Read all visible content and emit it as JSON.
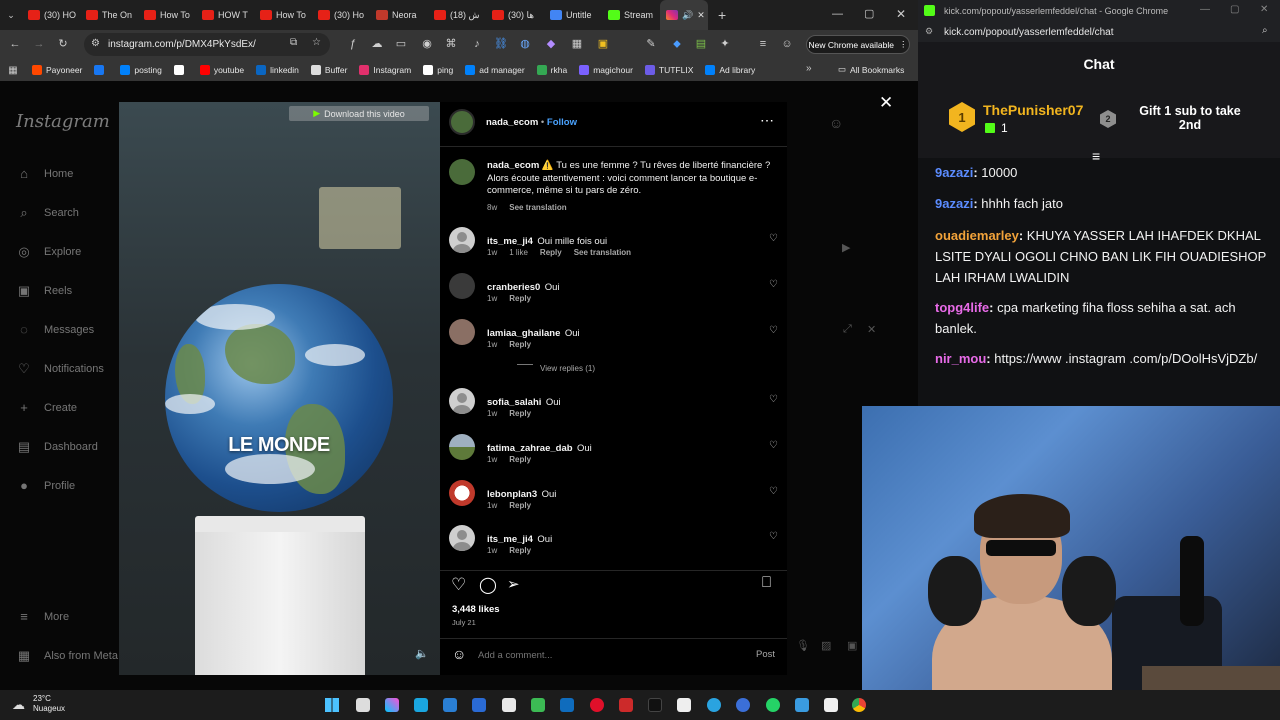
{
  "browser_left": {
    "tabs": [
      {
        "label": "(30) HO",
        "color": "#e62117"
      },
      {
        "label": "The On",
        "color": "#e62117"
      },
      {
        "label": "How To",
        "color": "#e62117"
      },
      {
        "label": "HOW T",
        "color": "#e62117"
      },
      {
        "label": "How To",
        "color": "#e62117"
      },
      {
        "label": "(30) Ho",
        "color": "#e62117"
      },
      {
        "label": "Neora",
        "color": "#c0392b"
      },
      {
        "label": "(18) ش",
        "color": "#e62117"
      },
      {
        "label": "(30) ها",
        "color": "#e62117"
      },
      {
        "label": "Untitle",
        "color": "#4285f4"
      },
      {
        "label": "Stream",
        "color": "#53fc18"
      }
    ],
    "url": "instagram.com/p/DMX4PkYsdEx/",
    "chrome_available": "New Chrome available",
    "bookmarks": [
      {
        "label": "Payoneer",
        "color": "#ff4800"
      },
      {
        "label": "",
        "color": "#1877f2"
      },
      {
        "label": "posting",
        "color": "#0081fb"
      },
      {
        "label": "",
        "color": "#ffffff"
      },
      {
        "label": "youtube",
        "color": "#ff0000"
      },
      {
        "label": "linkedin",
        "color": "#0a66c2"
      },
      {
        "label": "Buffer",
        "color": "#dddddd"
      },
      {
        "label": "Instagram",
        "color": "#e1306c"
      },
      {
        "label": "ping",
        "color": "#ffffff"
      },
      {
        "label": "ad manager",
        "color": "#0081fb"
      },
      {
        "label": "rkha",
        "color": "#34a853"
      },
      {
        "label": "magichour",
        "color": "#7b61ff"
      },
      {
        "label": "TUTFLIX",
        "color": "#6c5ce7"
      },
      {
        "label": "Ad library",
        "color": "#0081fb"
      }
    ],
    "all_bookmarks": "All Bookmarks"
  },
  "instagram": {
    "logo": "Instagram",
    "nav": [
      {
        "label": "Home",
        "icon": "home-icon",
        "glyph": "⌂"
      },
      {
        "label": "Search",
        "icon": "search-icon",
        "glyph": "⌕"
      },
      {
        "label": "Explore",
        "icon": "compass-icon",
        "glyph": "◎"
      },
      {
        "label": "Reels",
        "icon": "reels-icon",
        "glyph": "▣"
      },
      {
        "label": "Messages",
        "icon": "messenger-icon",
        "glyph": "◌"
      },
      {
        "label": "Notifications",
        "icon": "heart-icon",
        "glyph": "♡"
      },
      {
        "label": "Create",
        "icon": "plus-icon",
        "glyph": "+"
      },
      {
        "label": "Dashboard",
        "icon": "dashboard-icon",
        "glyph": "▤"
      },
      {
        "label": "Profile",
        "icon": "avatar-icon",
        "glyph": "●"
      }
    ],
    "more": "More",
    "also_from_meta": "Also from Meta",
    "video": {
      "download_label": "Download this video",
      "overlay_text": "LE MONDE"
    },
    "post": {
      "author": "nada_ecom",
      "follow": "Follow",
      "caption_user": "nada_ecom",
      "caption_lines": [
        "⚠️ Tu es une femme ? Tu rêves de liberté financière ?",
        "Alors écoute attentivement : voici comment lancer ta boutique e-",
        "commerce, même si tu pars de zéro."
      ],
      "caption_age": "8w",
      "see_translation": "See translation",
      "comments": [
        {
          "user": "its_me_ji4",
          "text": "Oui mille fois oui",
          "age": "1w",
          "likes": "1 like",
          "reply": "Reply",
          "translation": "See translation"
        },
        {
          "user": "cranberies0",
          "text": "Oui",
          "age": "1w",
          "likes": "",
          "reply": "Reply",
          "translation": ""
        },
        {
          "user": "lamiaa_ghailane",
          "text": "Oui",
          "age": "1w",
          "likes": "",
          "reply": "Reply",
          "translation": ""
        },
        {
          "user": "sofia_salahi",
          "text": "Oui",
          "age": "1w",
          "likes": "",
          "reply": "Reply",
          "translation": ""
        },
        {
          "user": "fatima_zahrae_dab",
          "text": "Oui",
          "age": "1w",
          "likes": "",
          "reply": "Reply",
          "translation": ""
        },
        {
          "user": "lebonplan3",
          "text": "Oui",
          "age": "1w",
          "likes": "",
          "reply": "Reply",
          "translation": ""
        },
        {
          "user": "its_me_ji4",
          "text": "Oui",
          "age": "1w",
          "likes": "",
          "reply": "Reply",
          "translation": ""
        }
      ],
      "view_replies": "View replies (1)",
      "likes_count": "3,448 likes",
      "date": "July 21",
      "add_comment_placeholder": "Add a comment...",
      "post_button": "Post"
    }
  },
  "browser_right": {
    "window_title": "kick.com/popout/yasserlemfeddel/chat - Google Chrome",
    "url": "kick.com/popout/yasserlemfeddel/chat",
    "chat_title": "Chat",
    "gifter": {
      "rank": "1",
      "name": "ThePunisher07",
      "count": "1",
      "next_rank": "2",
      "cta": "Gift 1 sub to take 2nd"
    },
    "messages": [
      {
        "user": "9azazi",
        "color": "#5b8cff",
        "text": "10000"
      },
      {
        "user": "9azazi",
        "color": "#5b8cff",
        "text": "hhhh fach jato"
      },
      {
        "user": "ouadiemarley",
        "color": "#f2a33a",
        "text": "KHUYA YASSER LAH IHAFDEK DKHAL LSITE DYALI OGOLI CHNO BAN LIK FIH OUADIESHOP LAH IRHAM LWALIDIN"
      },
      {
        "user": "topg4life",
        "color": "#e86be8",
        "text": "cpa marketing fiha floss sehiha a sat. ach banlek."
      },
      {
        "user": "nir_mou",
        "color": "#e86be8",
        "text": "https://www .instagram .com/p/DOolHsVjDZb/"
      }
    ]
  },
  "taskbar": {
    "temperature": "23°C",
    "weather": "Nuageux"
  }
}
